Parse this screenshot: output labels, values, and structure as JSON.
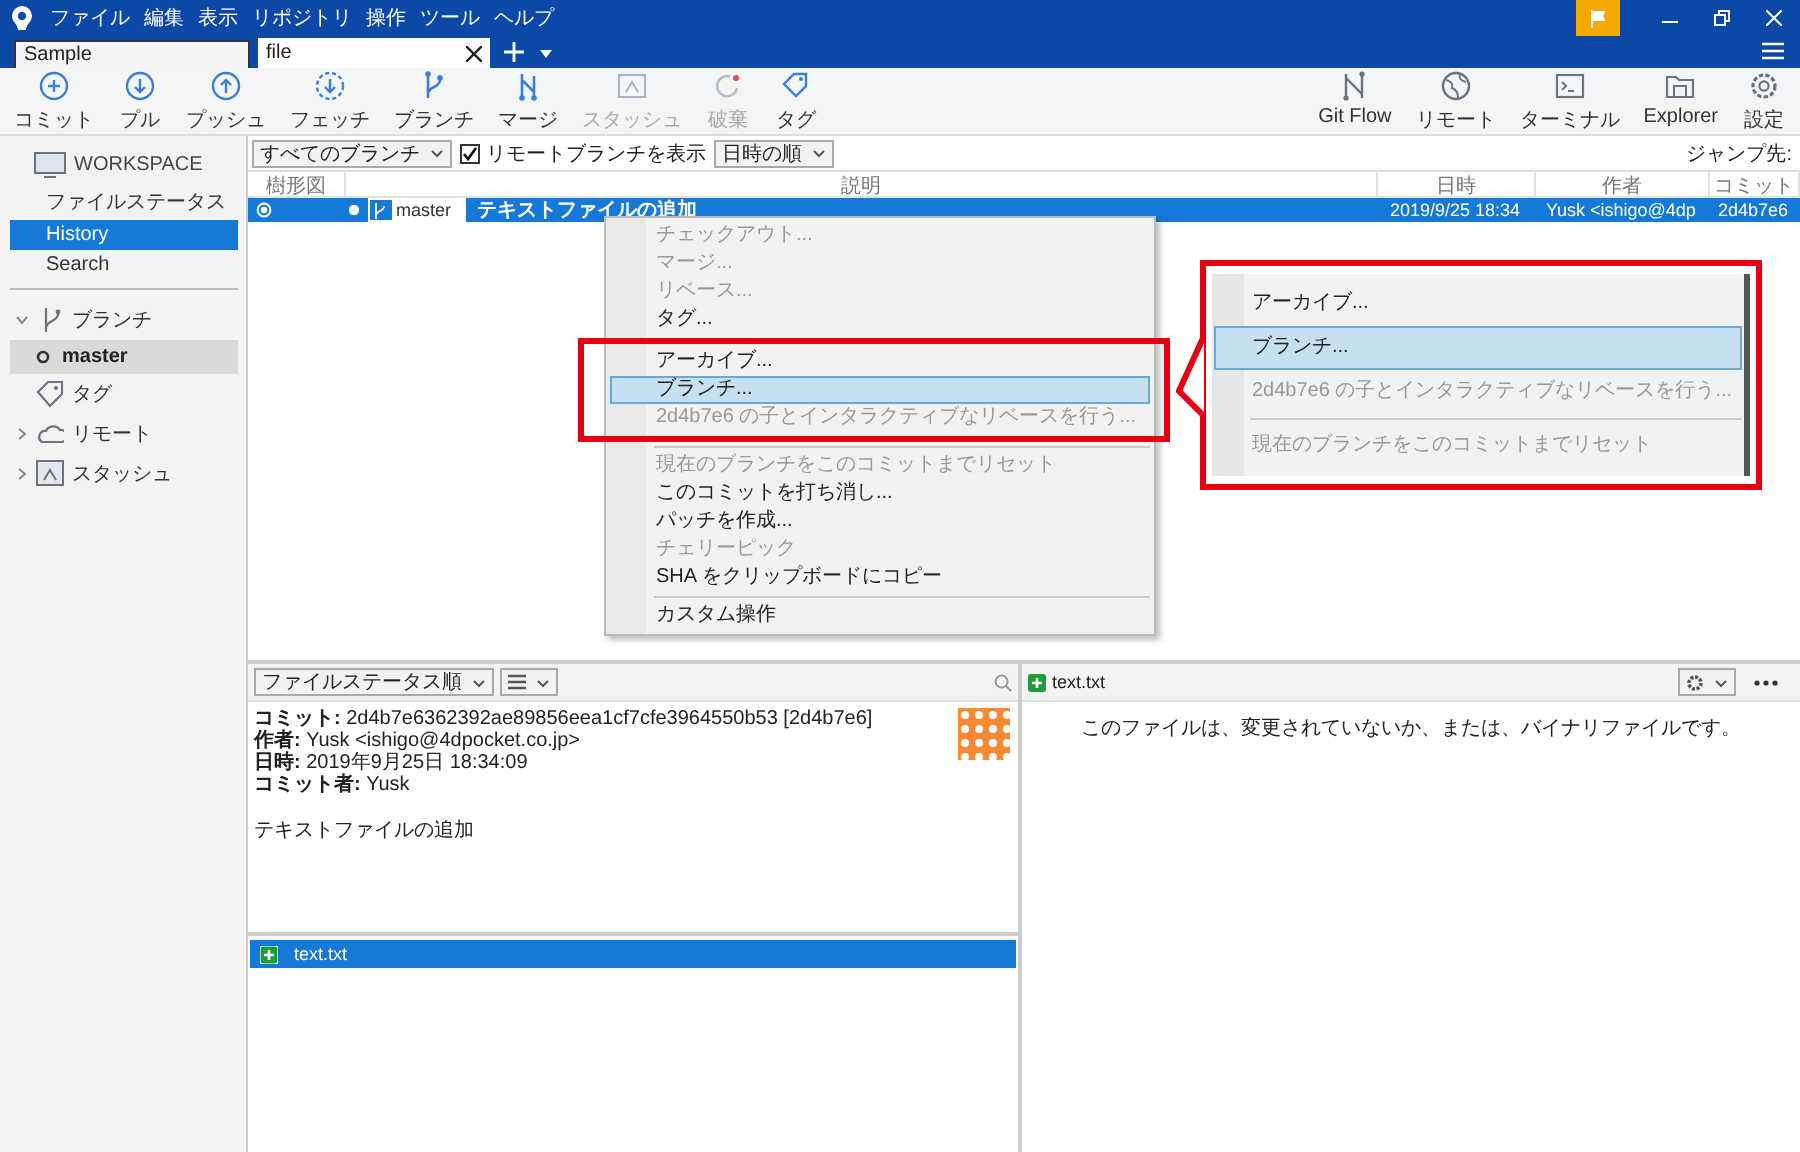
{
  "menubar": {
    "items": [
      "ファイル",
      "編集",
      "表示",
      "リポジトリ",
      "操作",
      "ツール",
      "ヘルプ"
    ]
  },
  "tabs": [
    {
      "label": "Sample",
      "selected": false
    },
    {
      "label": "file",
      "selected": true
    }
  ],
  "toolbar": {
    "left": [
      {
        "label": "コミット",
        "disabled": false
      },
      {
        "label": "プル",
        "disabled": false
      },
      {
        "label": "プッシュ",
        "disabled": false
      },
      {
        "label": "フェッチ",
        "disabled": false
      },
      {
        "label": "ブランチ",
        "disabled": false
      },
      {
        "label": "マージ",
        "disabled": false
      },
      {
        "label": "スタッシュ",
        "disabled": true
      },
      {
        "label": "破棄",
        "disabled": true
      },
      {
        "label": "タグ",
        "disabled": false
      }
    ],
    "right": [
      {
        "label": "Git Flow",
        "disabled": false
      },
      {
        "label": "リモート",
        "disabled": false
      },
      {
        "label": "ターミナル",
        "disabled": false
      },
      {
        "label": "Explorer",
        "disabled": false
      },
      {
        "label": "設定",
        "disabled": false
      }
    ]
  },
  "sidebar": {
    "workspace": "WORKSPACE",
    "items": [
      {
        "label": "ファイルステータス",
        "selected": false
      },
      {
        "label": "History",
        "selected": true
      },
      {
        "label": "Search",
        "selected": false
      }
    ],
    "sections": [
      {
        "label": "ブランチ",
        "expanded": true,
        "children": [
          {
            "label": "master",
            "selected": true
          }
        ]
      },
      {
        "label": "タグ"
      },
      {
        "label": "リモート",
        "expanded": false
      },
      {
        "label": "スタッシュ",
        "expanded": false
      }
    ]
  },
  "filter_bar": {
    "branches": "すべてのブランチ",
    "show_remote": {
      "label": "リモートブランチを表示",
      "checked": true
    },
    "sort": "日時の順",
    "jump_label": "ジャンプ先:"
  },
  "table": {
    "columns": [
      "樹形図",
      "説明",
      "日時",
      "作者",
      "コミット"
    ],
    "rows": [
      {
        "branch": "master",
        "description": "テキストファイルの追加",
        "date": "2019/9/25  18:34",
        "author": "Yusk <ishigo@4dp",
        "commit": "2d4b7e6",
        "selected": true
      }
    ]
  },
  "context_menu": {
    "items": [
      {
        "kind": "item",
        "label": "チェックアウト...",
        "disabled": true,
        "selected": false
      },
      {
        "kind": "item",
        "label": "マージ...",
        "disabled": true,
        "selected": false
      },
      {
        "kind": "item",
        "label": "リベース...",
        "disabled": true,
        "selected": false
      },
      {
        "kind": "item",
        "label": "タグ...",
        "disabled": false,
        "selected": false
      },
      {
        "kind": "group",
        "highlighted": true,
        "items": [
          {
            "kind": "item",
            "label": "アーカイブ...",
            "disabled": false,
            "selected": false
          },
          {
            "kind": "item",
            "label": "ブランチ...",
            "disabled": false,
            "selected": true
          },
          {
            "kind": "item",
            "label": "2d4b7e6 の子とインタラクティブなリベースを行う...",
            "disabled": true,
            "selected": false
          }
        ]
      },
      {
        "kind": "separator"
      },
      {
        "kind": "item",
        "label": "現在のブランチをこのコミットまでリセット",
        "disabled": true,
        "selected": false
      },
      {
        "kind": "item",
        "label": "このコミットを打ち消し...",
        "disabled": false,
        "selected": false
      },
      {
        "kind": "item",
        "label": "パッチを作成...",
        "disabled": false,
        "selected": false
      },
      {
        "kind": "item",
        "label": "チェリーピック",
        "disabled": true,
        "selected": false
      },
      {
        "kind": "item",
        "label": "SHA をクリップボードにコピー",
        "disabled": false,
        "selected": false
      },
      {
        "kind": "separator"
      },
      {
        "kind": "item",
        "label": "カスタム操作",
        "disabled": false,
        "selected": false
      }
    ]
  },
  "callout": {
    "items": [
      {
        "kind": "item",
        "label": "アーカイブ...",
        "disabled": false,
        "selected": false
      },
      {
        "kind": "item",
        "label": "ブランチ...",
        "disabled": false,
        "selected": true
      },
      {
        "kind": "item",
        "label": "2d4b7e6 の子とインタラクティブなリベースを行う...",
        "disabled": true,
        "selected": false
      },
      {
        "kind": "separator"
      },
      {
        "kind": "item",
        "label": "現在のブランチをこのコミットまでリセット",
        "disabled": true,
        "selected": false
      }
    ]
  },
  "details": {
    "sort": "ファイルステータス順",
    "lines": [
      "**コミット:** 2d4b7e6362392ae89856eea1cf7cfe3964550b53 [2d4b7e6]",
      "**作者:** Yusk <ishigo@4dpocket.co.jp>",
      "**日時:** 2019年9月25日 18:34:09",
      "**コミット者:** Yusk"
    ],
    "message": "テキストファイルの追加",
    "files": [
      {
        "name": "text.txt",
        "selected": true
      }
    ]
  },
  "diff": {
    "file": "text.txt",
    "message": "このファイルは、変更されていないか、または、バイナリファイルです。"
  }
}
